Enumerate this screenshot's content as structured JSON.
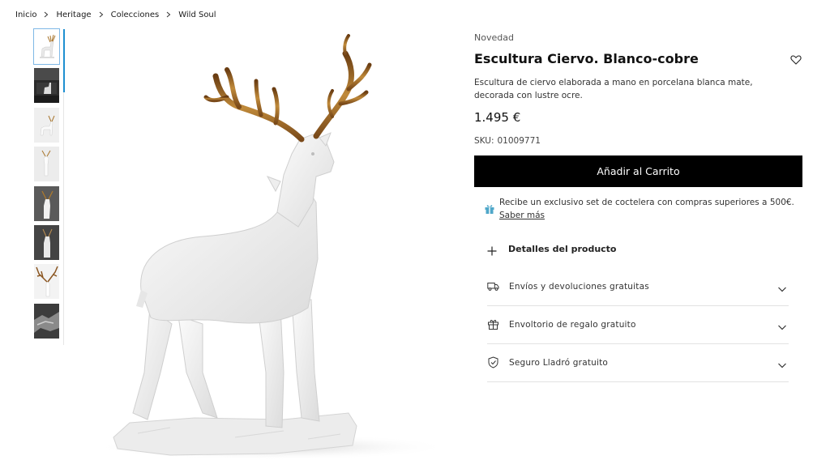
{
  "breadcrumb": [
    "Inicio",
    "Heritage",
    "Colecciones",
    "Wild Soul"
  ],
  "gallery": {
    "thumbnails": [
      {
        "name": "thumb-white-deer",
        "theme": "light"
      },
      {
        "name": "thumb-dark-room",
        "theme": "dark"
      },
      {
        "name": "thumb-deer-side",
        "theme": "light"
      },
      {
        "name": "thumb-deer-front",
        "theme": "light"
      },
      {
        "name": "thumb-deer-dark-bg",
        "theme": "dark"
      },
      {
        "name": "thumb-deer-head-dark",
        "theme": "dark"
      },
      {
        "name": "thumb-antler-detail",
        "theme": "light"
      },
      {
        "name": "thumb-texture-closeup",
        "theme": "dark"
      }
    ]
  },
  "product": {
    "badge": "Novedad",
    "title": "Escultura Ciervo. Blanco-cobre",
    "description": "Escultura de ciervo elaborada a mano en porcelana blanca mate, decorada con lustre ocre.",
    "price": "1.495 €",
    "sku_label": "SKU:",
    "sku": "01009771",
    "add_to_cart": "Añadir al Carrito"
  },
  "promo": {
    "text": "Recibe un exclusivo set de coctelera con compras superiores a 500€.",
    "link": "Saber más"
  },
  "details_label": "Detalles del producto",
  "accordions": [
    {
      "label": "Envíos y devoluciones gratuitas",
      "icon": "truck-icon"
    },
    {
      "label": "Envoltorio de regalo gratuito",
      "icon": "gift-icon"
    },
    {
      "label": "Seguro Lladró gratuito",
      "icon": "shield-icon"
    }
  ],
  "colors": {
    "cart_bg": "#000000",
    "thumb_active": "#1e8fd1",
    "antler_gold": "#b07a2a",
    "promo_gift": "#4fa7c9"
  }
}
